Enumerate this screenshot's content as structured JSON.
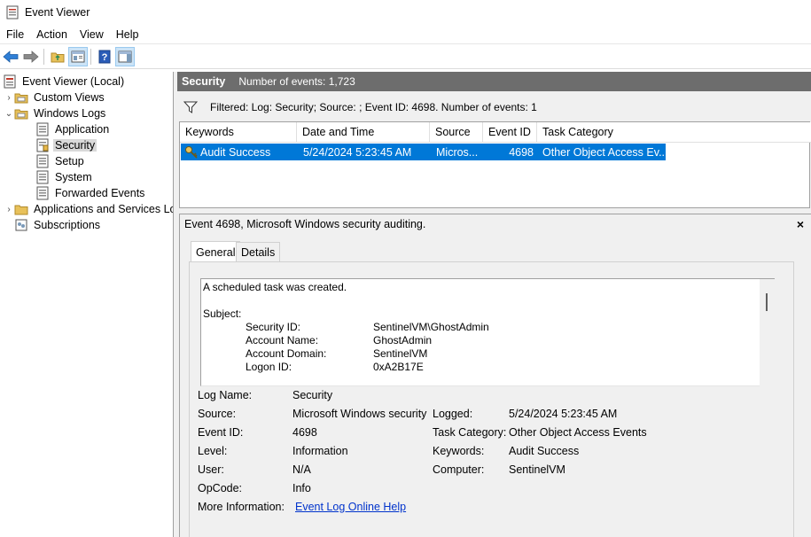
{
  "window": {
    "title": "Event Viewer"
  },
  "menu": [
    "File",
    "Action",
    "View",
    "Help"
  ],
  "toolbar": {
    "buttons": [
      "back-arrow-icon",
      "forward-arrow-icon",
      "open-folder-icon",
      "properties-pane-icon",
      "help-icon",
      "show-action-pane-icon"
    ]
  },
  "tree": {
    "root": "Event Viewer (Local)",
    "custom_views": "Custom Views",
    "windows_logs": "Windows Logs",
    "logs": [
      "Application",
      "Security",
      "Setup",
      "System",
      "Forwarded Events"
    ],
    "apps_services": "Applications and Services Lo",
    "subscriptions": "Subscriptions"
  },
  "header": {
    "title": "Security",
    "count": "Number of events: 1,723"
  },
  "filter": {
    "text": "Filtered: Log: Security; Source: ; Event ID: 4698. Number of events: 1"
  },
  "grid": {
    "columns": [
      "Keywords",
      "Date and Time",
      "Source",
      "Event ID",
      "Task Category"
    ],
    "row": {
      "keywords": "Audit Success",
      "date": "5/24/2024 5:23:45 AM",
      "source": "Micros...",
      "event_id": "4698",
      "task_category": "Other Object Access Ev..."
    }
  },
  "detail": {
    "title": "Event 4698, Microsoft Windows security auditing.",
    "close": "×",
    "tabs": [
      "General",
      "Details"
    ],
    "description": {
      "line1": "A scheduled task was created.",
      "subject": "Subject:",
      "fields": [
        {
          "label": "Security ID:",
          "value": "SentinelVM\\GhostAdmin"
        },
        {
          "label": "Account Name:",
          "value": "GhostAdmin"
        },
        {
          "label": "Account Domain:",
          "value": "SentinelVM"
        },
        {
          "label": "Logon ID:",
          "value": "0xA2B17E"
        }
      ]
    },
    "props": {
      "log_name_label": "Log Name:",
      "log_name": "Security",
      "source_label": "Source:",
      "source": "Microsoft Windows security",
      "logged_label": "Logged:",
      "logged": "5/24/2024 5:23:45 AM",
      "event_id_label": "Event ID:",
      "event_id": "4698",
      "task_category_label": "Task Category:",
      "task_category": "Other Object Access Events",
      "level_label": "Level:",
      "level": "Information",
      "keywords_label": "Keywords:",
      "keywords": "Audit Success",
      "user_label": "User:",
      "user": "N/A",
      "computer_label": "Computer:",
      "computer": "SentinelVM",
      "opcode_label": "OpCode:",
      "opcode": "Info",
      "more_info_label": "More Information:",
      "more_info": "Event Log Online Help"
    }
  },
  "colors": {
    "selection": "#0078d7",
    "header_bg": "#6d6d6d",
    "link": "#0033cc"
  }
}
